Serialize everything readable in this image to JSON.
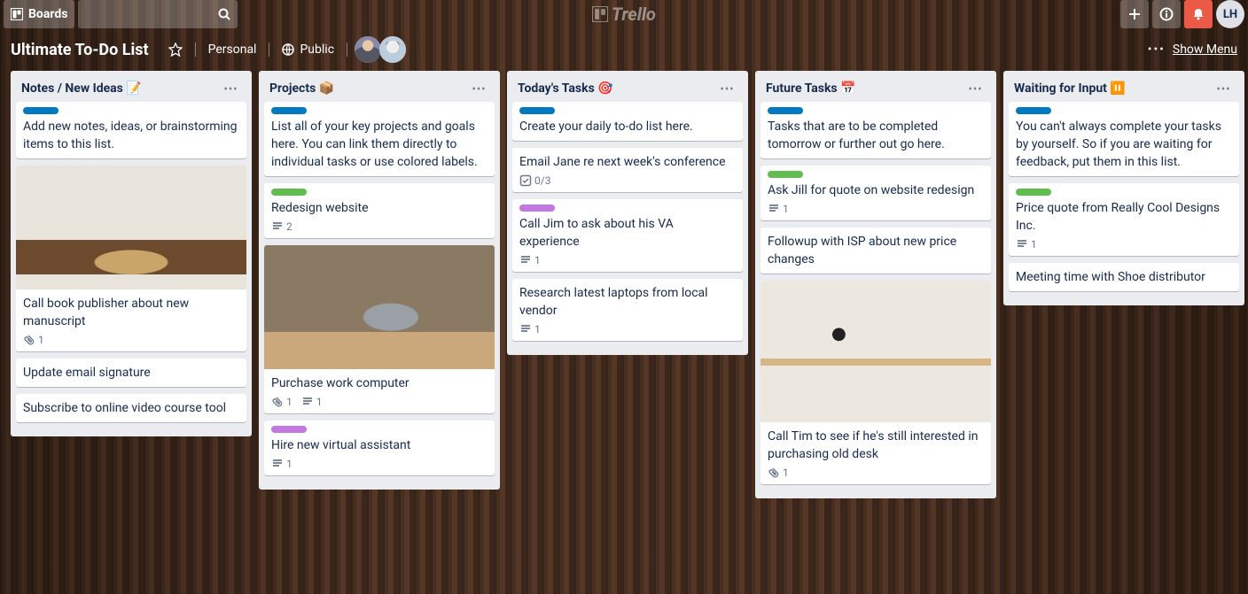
{
  "header": {
    "boards_label": "Boards",
    "search_placeholder": "",
    "logo_text": "Trello",
    "user_initials": "LH"
  },
  "board": {
    "name": "Ultimate To-Do List",
    "team": "Personal",
    "visibility": "Public",
    "show_menu": "Show Menu"
  },
  "label_colors": {
    "blue": "#0079bf",
    "green": "#61bd4f",
    "purple": "#c377e0"
  },
  "lists": [
    {
      "title": "Notes / New Ideas 📝",
      "cards": [
        {
          "labels": [
            "blue"
          ],
          "title": "Add new notes, ideas, or brainstorming items to this list."
        },
        {
          "cover": "book",
          "title": "Call book publisher about new manuscript",
          "badges": [
            {
              "type": "attach",
              "text": "1"
            }
          ]
        },
        {
          "title": "Update email signature"
        },
        {
          "title": "Subscribe to online video course tool"
        }
      ]
    },
    {
      "title": "Projects 📦",
      "cards": [
        {
          "labels": [
            "blue"
          ],
          "title": "List all of your key projects and goals here. You can link them directly to individual tasks or use colored labels."
        },
        {
          "labels": [
            "green"
          ],
          "title": "Redesign website",
          "badges": [
            {
              "type": "desc",
              "text": "2"
            }
          ]
        },
        {
          "cover": "laptop",
          "title": "Purchase work computer",
          "badges": [
            {
              "type": "attach",
              "text": "1"
            },
            {
              "type": "desc",
              "text": "1"
            }
          ]
        },
        {
          "labels": [
            "purple"
          ],
          "title": "Hire new virtual assistant",
          "badges": [
            {
              "type": "desc",
              "text": "1"
            }
          ]
        }
      ]
    },
    {
      "title": "Today's Tasks 🎯",
      "cards": [
        {
          "labels": [
            "blue"
          ],
          "title": "Create your daily to-do list here."
        },
        {
          "title": "Email Jane re next week's conference",
          "badges": [
            {
              "type": "check",
              "text": "0/3"
            }
          ]
        },
        {
          "labels": [
            "purple"
          ],
          "title": "Call Jim to ask about his VA experience",
          "badges": [
            {
              "type": "desc",
              "text": "1"
            }
          ]
        },
        {
          "title": "Research latest laptops from local vendor",
          "badges": [
            {
              "type": "desc",
              "text": "1"
            }
          ]
        }
      ]
    },
    {
      "title": "Future Tasks 📅",
      "cards": [
        {
          "labels": [
            "blue"
          ],
          "title": "Tasks that are to be completed tomorrow or further out go here."
        },
        {
          "labels": [
            "green"
          ],
          "title": "Ask Jill for quote on website redesign",
          "badges": [
            {
              "type": "desc",
              "text": "1"
            }
          ]
        },
        {
          "title": "Followup with ISP about new price changes"
        },
        {
          "cover": "desk",
          "title": "Call Tim to see if he's still interested in purchasing old desk",
          "badges": [
            {
              "type": "attach",
              "text": "1"
            }
          ]
        }
      ]
    },
    {
      "title": "Waiting for Input ⏸️",
      "cards": [
        {
          "labels": [
            "blue"
          ],
          "title": "You can't always complete your tasks by yourself. So if you are waiting for feedback, put them in this list."
        },
        {
          "labels": [
            "green"
          ],
          "title": "Price quote from Really Cool Designs Inc.",
          "badges": [
            {
              "type": "desc",
              "text": "1"
            }
          ]
        },
        {
          "title": "Meeting time with Shoe distributor"
        }
      ]
    }
  ]
}
